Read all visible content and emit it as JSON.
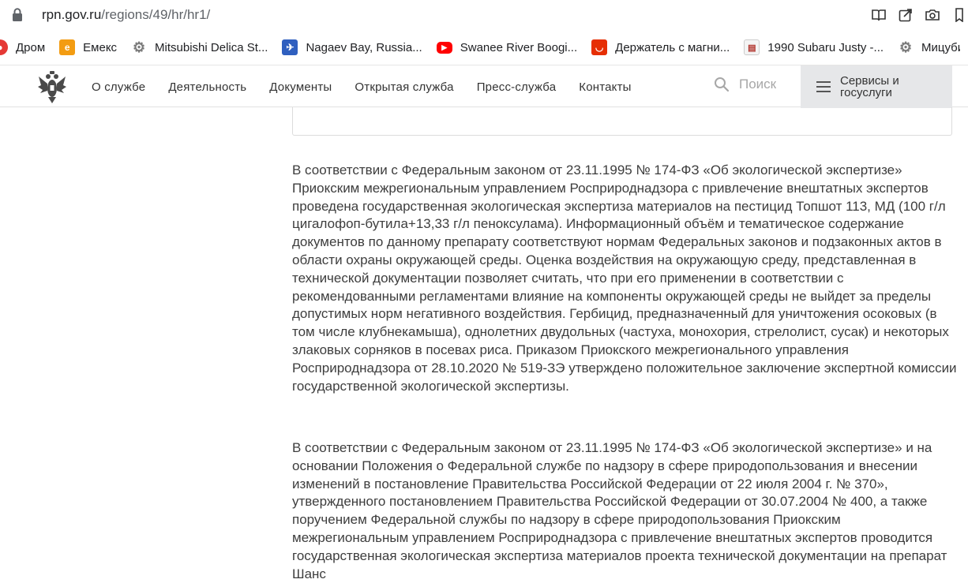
{
  "browser": {
    "url_host": "rpn.gov.ru",
    "url_path": "/regions/49/hr/hr1/",
    "bookmarks": [
      {
        "label": "Дром",
        "icon": "drom-icon",
        "color": "#e53935"
      },
      {
        "label": "Емекс",
        "icon": "emex-icon",
        "color": "#f39c12"
      },
      {
        "label": "Mitsubishi Delica St...",
        "icon": "gear-icon",
        "color": "#7a7a7a"
      },
      {
        "label": "Nagaev Bay, Russia...",
        "icon": "globe-icon",
        "color": "#2f5fbf"
      },
      {
        "label": "Swanee River Boogi...",
        "icon": "youtube-icon",
        "color": "#ff0000"
      },
      {
        "label": "Держатель с магни...",
        "icon": "aliexpress-icon",
        "color": "#e62e04"
      },
      {
        "label": "1990 Subaru Justy -...",
        "icon": "document-icon",
        "color": "#b0312a"
      },
      {
        "label": "Мицубиси Падж",
        "icon": "gear-icon",
        "color": "#7a7a7a"
      }
    ]
  },
  "nav": {
    "links": [
      "О службе",
      "Деятельность",
      "Документы",
      "Открытая служба",
      "Пресс-служба",
      "Контакты"
    ],
    "search_label": "Поиск",
    "services_label": "Сервисы и госуслуги"
  },
  "content": {
    "paragraph1": "В соответствии с Федеральным законом от 23.11.1995 № 174-ФЗ «Об экологической экспертизе» Приокским межрегиональным управлением Росприроднадзора с привлечение внештатных экспертов проведена государственная экологическая экспертиза материалов на пестицид Топшот 113, МД (100 г/л цигалофоп-бутила+13,33 г/л пеноксулама). Информационный объём и тематическое содержание документов по данному препарату соответствуют нормам Федеральных законов и подзаконных актов в области охраны окружающей среды. Оценка воздействия на окружающую среду, представленная в технической документации позволяет считать, что при его применении в соответствии с рекомендованными регламентами влияние на компоненты окружающей среды не выйдет за пределы допустимых норм негативного воздействия. Гербицид, предназначенный для уничтожения осоковых (в том числе клубнекамыша), однолетних двудольных (частуха, монохория, стрелолист, сусак) и некоторых злаковых сорняков в посевах риса. Приказом Приокского межрегионального управления Росприроднадзора от 28.10.2020 № 519-ЗЭ утверждено положительное заключение экспертной комиссии государственной экологической экспертизы.",
    "paragraph2": "В соответствии с Федеральным законом от 23.11.1995 № 174-ФЗ «Об экологической экспертизе» и на основании Положения о Федеральной службе по надзору в сфере природопользования и внесении изменений в постановление Правительства Российской Федерации от 22 июля 2004 г. № 370», утвержденного постановлением Правительства Российской Федерации от 30.07.2004 № 400, а также поручением Федеральной службы по надзору в сфере природопользования Приокским межрегиональным управлением Росприроднадзора с привлечение внештатных экспертов проводится государственная экологическая экспертиза материалов проекта технической документации на препарат Шанс"
  }
}
